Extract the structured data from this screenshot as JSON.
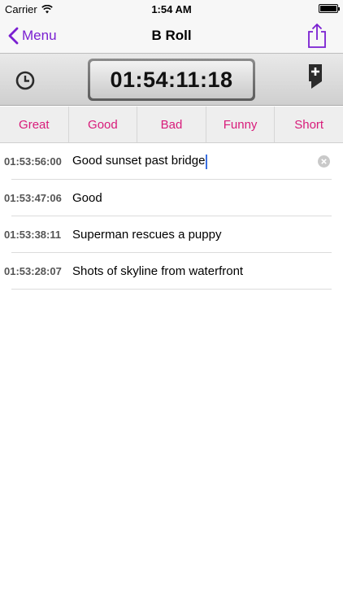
{
  "status_bar": {
    "carrier": "Carrier",
    "time": "1:54 AM"
  },
  "nav": {
    "back_label": "Menu",
    "title": "B Roll"
  },
  "timer": {
    "timecode": "01:54:11:18"
  },
  "tags": [
    "Great",
    "Good",
    "Bad",
    "Funny",
    "Short"
  ],
  "notes": [
    {
      "time": "01:53:56:00",
      "text": "Good sunset past bridge",
      "editing": true
    },
    {
      "time": "01:53:47:06",
      "text": "Good"
    },
    {
      "time": "01:53:38:11",
      "text": "Superman rescues a puppy"
    },
    {
      "time": "01:53:28:07",
      "text": "Shots of skyline from waterfront"
    }
  ],
  "colors": {
    "accent": "#7a1fd1",
    "tag_text": "#d81b7a",
    "caret": "#3a6fe0"
  },
  "icons": {
    "share": "share-icon",
    "clock": "clock-icon",
    "marker": "add-marker-icon",
    "clear": "clear-text-icon"
  }
}
